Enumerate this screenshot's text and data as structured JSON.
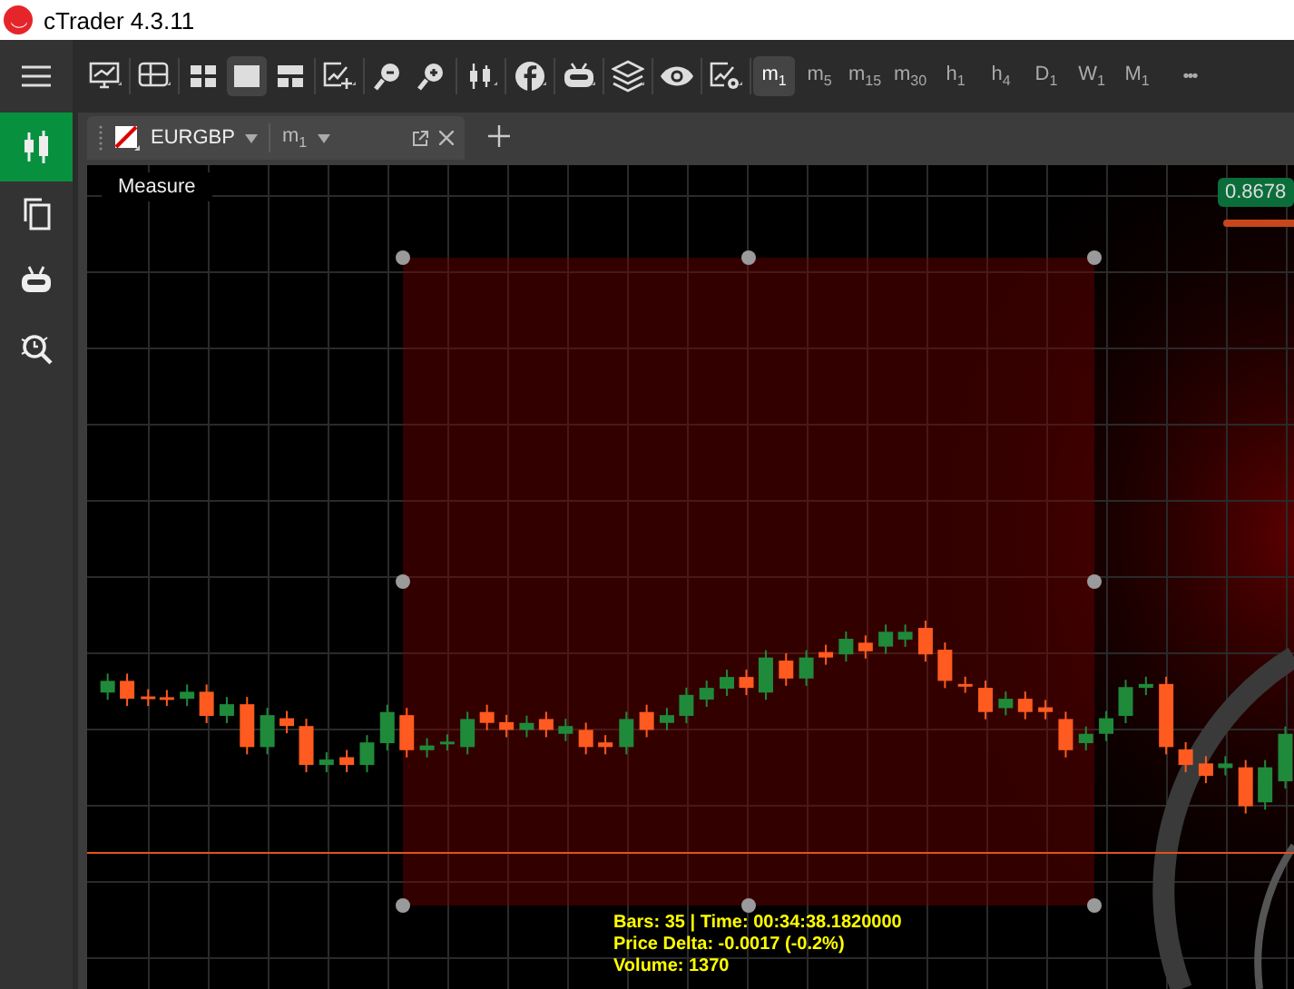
{
  "window": {
    "title": "cTrader 4.3.11"
  },
  "toolbar": {
    "tools": [
      {
        "kind": "monitor"
      },
      {
        "kind": "panels"
      },
      {
        "kind": "layout-grid",
        "selected": false
      },
      {
        "kind": "layout-single",
        "selected": true
      },
      {
        "kind": "layout-split",
        "selected": false
      },
      {
        "kind": "chart-add"
      },
      {
        "kind": "zoom-out"
      },
      {
        "kind": "zoom-in"
      },
      {
        "kind": "candles"
      },
      {
        "kind": "social"
      },
      {
        "kind": "robot"
      },
      {
        "kind": "layers"
      },
      {
        "kind": "eye"
      },
      {
        "kind": "chart-settings"
      }
    ],
    "timeframes": [
      {
        "label": "m$_{1}$",
        "selected": true
      },
      {
        "label": "m$_{5}$",
        "selected": false
      },
      {
        "label": "m$_{15}$",
        "selected": false
      },
      {
        "label": "m$_{30}$",
        "selected": false
      },
      {
        "label": "h$_{1}$",
        "selected": false
      },
      {
        "label": "h$_{4}$",
        "selected": false
      },
      {
        "label": "D$_{1}$",
        "selected": false
      },
      {
        "label": "W$_{1}$",
        "selected": false
      },
      {
        "label": "M$_{1}$",
        "selected": false
      }
    ],
    "more": "•••"
  },
  "sidebar": {
    "items": [
      {
        "kind": "trade",
        "selected": true
      },
      {
        "kind": "copy",
        "selected": false
      },
      {
        "kind": "robot",
        "selected": false
      },
      {
        "kind": "analyze",
        "selected": false
      }
    ]
  },
  "tab": {
    "symbol": "EURGBP",
    "timeframe": "m$_{1}$",
    "selected": true
  },
  "chart": {
    "measure_label": "Measure",
    "price_label": "0.8678",
    "measurement": [
      "Bars: 35 | Time: 00:34:38.1820000",
      "Price Delta: -0.0017 (-0.2%)",
      "Volume: 1370"
    ]
  }
}
